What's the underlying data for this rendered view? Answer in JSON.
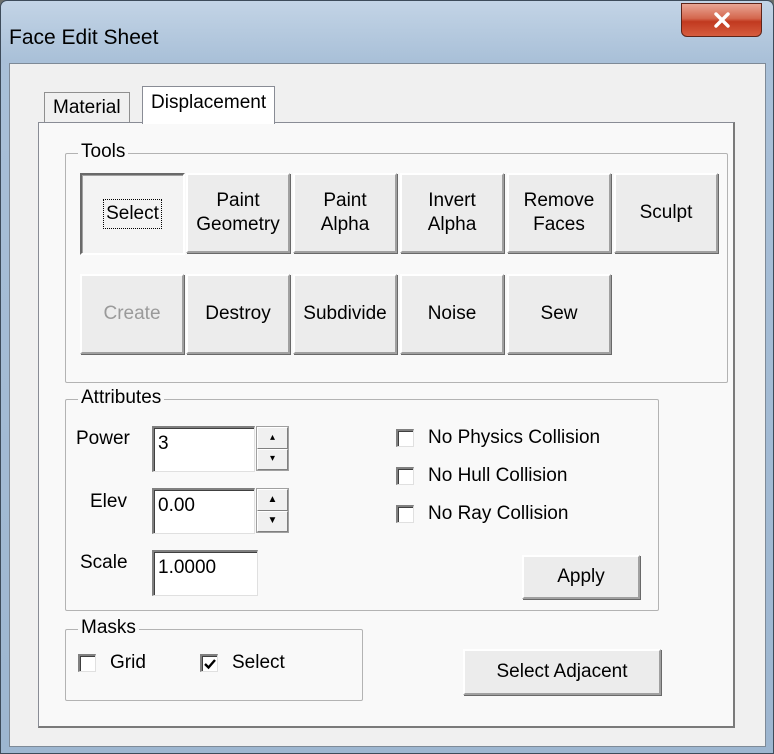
{
  "window": {
    "title": "Face Edit Sheet",
    "close_glyph": "✕"
  },
  "tabs": [
    {
      "label": "Material",
      "active": false
    },
    {
      "label": "Displacement",
      "active": true
    }
  ],
  "tools": {
    "label": "Tools",
    "row1": [
      {
        "label": "Select",
        "state": "pressed"
      },
      {
        "label": "Paint\nGeometry"
      },
      {
        "label": "Paint\nAlpha"
      },
      {
        "label": "Invert\nAlpha"
      },
      {
        "label": "Remove\nFaces"
      },
      {
        "label": "Sculpt"
      }
    ],
    "row2": [
      {
        "label": "Create",
        "state": "disabled"
      },
      {
        "label": "Destroy"
      },
      {
        "label": "Subdivide"
      },
      {
        "label": "Noise"
      },
      {
        "label": "Sew"
      }
    ]
  },
  "attributes": {
    "label": "Attributes",
    "power": {
      "label": "Power",
      "value": "3"
    },
    "elev": {
      "label": "Elev",
      "value": "0.00"
    },
    "scale": {
      "label": "Scale",
      "value": "1.0000"
    },
    "checks": [
      {
        "label": "No Physics Collision",
        "checked": false
      },
      {
        "label": "No Hull Collision",
        "checked": false
      },
      {
        "label": "No Ray Collision",
        "checked": false
      }
    ],
    "apply_label": "Apply"
  },
  "masks": {
    "label": "Masks",
    "grid": {
      "label": "Grid",
      "checked": false
    },
    "select": {
      "label": "Select",
      "checked": true
    }
  },
  "select_adjacent_label": "Select Adjacent",
  "colors": {
    "close_button": "#c1391f",
    "title_bar": "#a9c0d8",
    "dialog_bg": "#f0f0f0"
  }
}
